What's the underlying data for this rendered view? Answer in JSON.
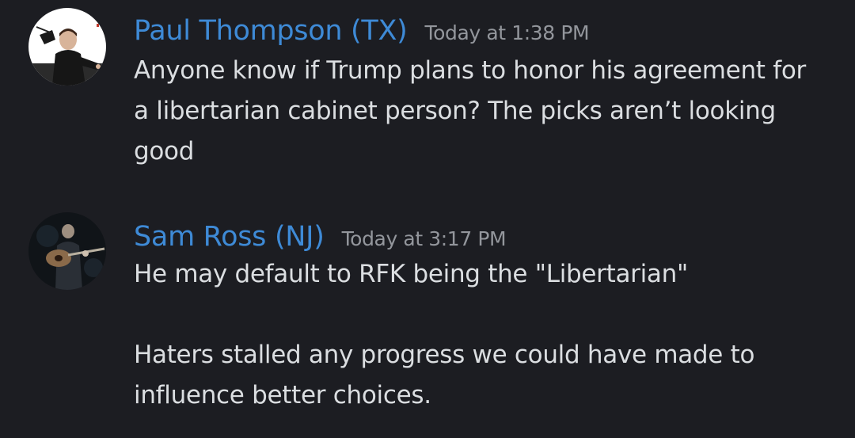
{
  "messages": [
    {
      "author": "Paul Thompson (TX)",
      "timestamp": "Today at 1:38 PM",
      "lines": [
        "Anyone know if Trump plans to honor his agreement for",
        "a libertarian cabinet person? The picks aren’t looking",
        "good"
      ]
    },
    {
      "author": "Sam Ross (NJ)",
      "timestamp": "Today at 3:17 PM",
      "paragraph_1": "He may default to RFK being the \"Libertarian\"",
      "paragraph_2_lines": [
        "Haters stalled any progress we could have made to",
        "influence better choices."
      ]
    }
  ],
  "colors": {
    "background": "#1c1d22",
    "username": "#3e8ad6",
    "timestamp": "#93969c",
    "text": "#dbdee1"
  }
}
